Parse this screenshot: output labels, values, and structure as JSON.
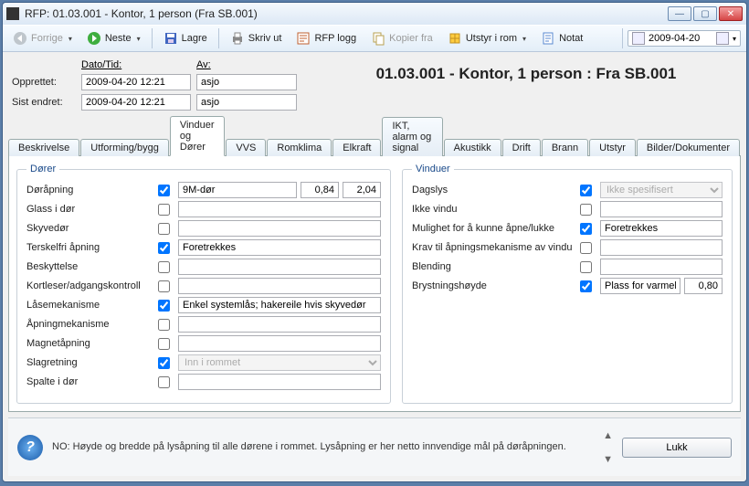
{
  "window": {
    "title": "RFP: 01.03.001 - Kontor, 1 person (Fra SB.001)"
  },
  "toolbar": {
    "prev": "Forrige",
    "next": "Neste",
    "save": "Lagre",
    "print": "Skriv ut",
    "rfplog": "RFP logg",
    "copy": "Kopier fra",
    "equip": "Utstyr i rom",
    "note": "Notat",
    "date": "2009-04-20"
  },
  "meta": {
    "dato_hdr": "Dato/Tid:",
    "av_hdr": "Av:",
    "created_lbl": "Opprettet:",
    "created_date": "2009-04-20 12:21",
    "created_by": "asjo",
    "modified_lbl": "Sist endret:",
    "modified_date": "2009-04-20 12:21",
    "modified_by": "asjo"
  },
  "main_title": "01.03.001 - Kontor, 1 person : Fra SB.001",
  "tabs": [
    "Beskrivelse",
    "Utforming/bygg",
    "Vinduer og Dører",
    "VVS",
    "Romklima",
    "Elkraft",
    "IKT, alarm og signal",
    "Akustikk",
    "Drift",
    "Brann",
    "Utstyr",
    "Bilder/Dokumenter"
  ],
  "active_tab": 2,
  "dorer": {
    "legend": "Dører",
    "rows": {
      "doorapning": {
        "label": "Døråpning",
        "checked": true,
        "value": "9M-dør",
        "w": "0,84",
        "h": "2,04"
      },
      "glass": {
        "label": "Glass i dør",
        "checked": false,
        "value": ""
      },
      "skyvedor": {
        "label": "Skyvedør",
        "checked": false,
        "value": ""
      },
      "terskel": {
        "label": "Terskelfri åpning",
        "checked": true,
        "value": "Foretrekkes"
      },
      "beskyttelse": {
        "label": "Beskyttelse",
        "checked": false,
        "value": ""
      },
      "kortleser": {
        "label": "Kortleser/adgangskontroll",
        "checked": false,
        "value": ""
      },
      "lasemek": {
        "label": "Låsemekanisme",
        "checked": true,
        "value": "Enkel systemlås; hakereile hvis skyvedør"
      },
      "apningmek": {
        "label": "Åpningmekanisme",
        "checked": false,
        "value": ""
      },
      "magnet": {
        "label": "Magnetåpning",
        "checked": false,
        "value": ""
      },
      "slagretning": {
        "label": "Slagretning",
        "checked": true,
        "value": "Inn i rommet",
        "is_select": true,
        "disabled": true
      },
      "spalte": {
        "label": "Spalte i dør",
        "checked": false,
        "value": ""
      }
    }
  },
  "vinduer": {
    "legend": "Vinduer",
    "rows": {
      "dagslys": {
        "label": "Dagslys",
        "checked": true,
        "value": "Ikke spesifisert",
        "is_select": true,
        "disabled": true
      },
      "ikkevindu": {
        "label": "Ikke vindu",
        "checked": false,
        "value": ""
      },
      "mulighet": {
        "label": "Mulighet for å kunne åpne/lukke",
        "checked": true,
        "value": "Foretrekkes"
      },
      "kravapn": {
        "label": "Krav til åpningsmekanisme av vindu",
        "checked": false,
        "value": ""
      },
      "blending": {
        "label": "Blending",
        "checked": false,
        "value": ""
      },
      "brystning": {
        "label": "Brystningshøyde",
        "checked": true,
        "value": "Plass for varmekilde og eluttak",
        "num": "0,80"
      }
    }
  },
  "footer": {
    "help": "NO: Høyde og bredde på lysåpning til alle dørene i rommet. Lysåpning er her netto innvendige mål på døråpningen.",
    "close": "Lukk"
  }
}
